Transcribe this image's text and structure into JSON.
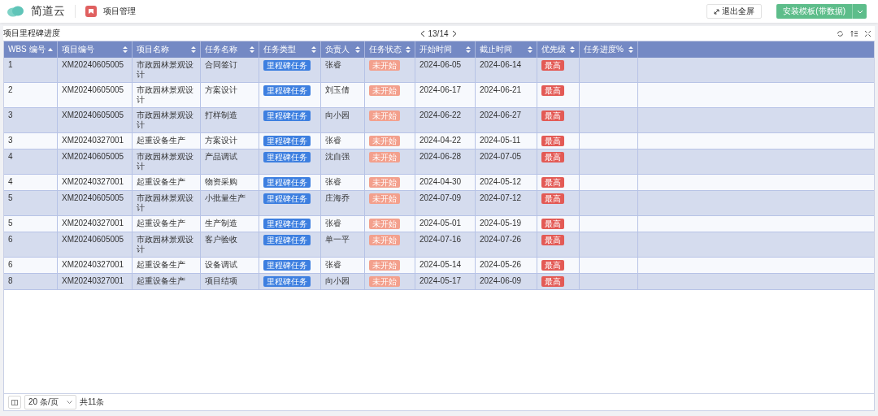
{
  "header": {
    "brand": "简道云",
    "app": "项目管理",
    "exit_button": "退出全屏",
    "install_button": "安装模板(带数据)"
  },
  "toolbar": {
    "title": "项目里程碑进度",
    "page": "13/14"
  },
  "table": {
    "columns": [
      {
        "label": "WBS 编号",
        "sorted": true
      },
      {
        "label": "项目编号",
        "sorted": false
      },
      {
        "label": "项目名称",
        "sorted": false
      },
      {
        "label": "任务名称",
        "sorted": false
      },
      {
        "label": "任务类型",
        "sorted": false
      },
      {
        "label": "负责人",
        "sorted": false
      },
      {
        "label": "任务状态",
        "sorted": false
      },
      {
        "label": "开始时间",
        "sorted": false
      },
      {
        "label": "截止时间",
        "sorted": false
      },
      {
        "label": "优先级",
        "sorted": false
      },
      {
        "label": "任务进度%",
        "sorted": false
      }
    ],
    "rows": [
      {
        "wbs": "1",
        "project_no": "XM20240605005",
        "project_name": "市政园林景观设计",
        "task_name": "合同签订",
        "task_type": "里程碑任务",
        "owner": "张睿",
        "status": "未开始",
        "start": "2024-06-05",
        "end": "2024-06-14",
        "priority": "最高"
      },
      {
        "wbs": "2",
        "project_no": "XM20240605005",
        "project_name": "市政园林景观设计",
        "task_name": "方案设计",
        "task_type": "里程碑任务",
        "owner": "刘玉倩",
        "status": "未开始",
        "start": "2024-06-17",
        "end": "2024-06-21",
        "priority": "最高"
      },
      {
        "wbs": "3",
        "project_no": "XM20240605005",
        "project_name": "市政园林景观设计",
        "task_name": "打样制造",
        "task_type": "里程碑任务",
        "owner": "向小园",
        "status": "未开始",
        "start": "2024-06-22",
        "end": "2024-06-27",
        "priority": "最高"
      },
      {
        "wbs": "3",
        "project_no": "XM20240327001",
        "project_name": "起重设备生产",
        "task_name": "方案设计",
        "task_type": "里程碑任务",
        "owner": "张睿",
        "status": "未开始",
        "start": "2024-04-22",
        "end": "2024-05-11",
        "priority": "最高"
      },
      {
        "wbs": "4",
        "project_no": "XM20240605005",
        "project_name": "市政园林景观设计",
        "task_name": "产品调试",
        "task_type": "里程碑任务",
        "owner": "沈自强",
        "status": "未开始",
        "start": "2024-06-28",
        "end": "2024-07-05",
        "priority": "最高"
      },
      {
        "wbs": "4",
        "project_no": "XM20240327001",
        "project_name": "起重设备生产",
        "task_name": "物资采购",
        "task_type": "里程碑任务",
        "owner": "张睿",
        "status": "未开始",
        "start": "2024-04-30",
        "end": "2024-05-12",
        "priority": "最高"
      },
      {
        "wbs": "5",
        "project_no": "XM20240605005",
        "project_name": "市政园林景观设计",
        "task_name": "小批量生产",
        "task_type": "里程碑任务",
        "owner": "庄海乔",
        "status": "未开始",
        "start": "2024-07-09",
        "end": "2024-07-12",
        "priority": "最高"
      },
      {
        "wbs": "5",
        "project_no": "XM20240327001",
        "project_name": "起重设备生产",
        "task_name": "生产制造",
        "task_type": "里程碑任务",
        "owner": "张睿",
        "status": "未开始",
        "start": "2024-05-01",
        "end": "2024-05-19",
        "priority": "最高"
      },
      {
        "wbs": "6",
        "project_no": "XM20240605005",
        "project_name": "市政园林景观设计",
        "task_name": "客户验收",
        "task_type": "里程碑任务",
        "owner": "单一平",
        "status": "未开始",
        "start": "2024-07-16",
        "end": "2024-07-26",
        "priority": "最高"
      },
      {
        "wbs": "6",
        "project_no": "XM20240327001",
        "project_name": "起重设备生产",
        "task_name": "设备调试",
        "task_type": "里程碑任务",
        "owner": "张睿",
        "status": "未开始",
        "start": "2024-05-14",
        "end": "2024-05-26",
        "priority": "最高"
      },
      {
        "wbs": "8",
        "project_no": "XM20240327001",
        "project_name": "起重设备生产",
        "task_name": "项目结项",
        "task_type": "里程碑任务",
        "owner": "向小园",
        "status": "未开始",
        "start": "2024-05-17",
        "end": "2024-06-09",
        "priority": "最高"
      }
    ]
  },
  "footer": {
    "page_size": "20 条/页",
    "total": "共11条"
  }
}
